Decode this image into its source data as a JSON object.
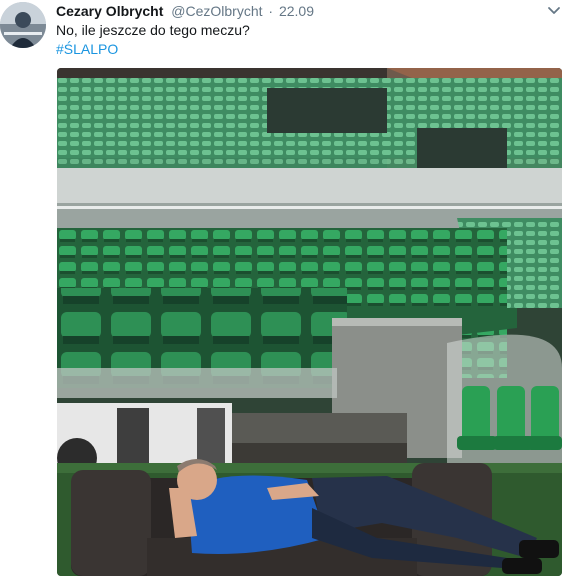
{
  "tweet": {
    "display_name": "Cezary Olbrycht",
    "handle": "@CezOlbrycht",
    "separator": "·",
    "timestamp": "22.09",
    "text": "No,  ile jeszcze do tego meczu?",
    "hashtag": "#ŚLALPO",
    "avatar_icon": "profile-avatar",
    "menu_icon": "chevron-down-icon",
    "media_alt": "stadium-seats-couch-photo"
  },
  "colors": {
    "link": "#1b95e0",
    "text": "#14171a",
    "secondary": "#657786",
    "seat_green": "#2f9a57"
  }
}
